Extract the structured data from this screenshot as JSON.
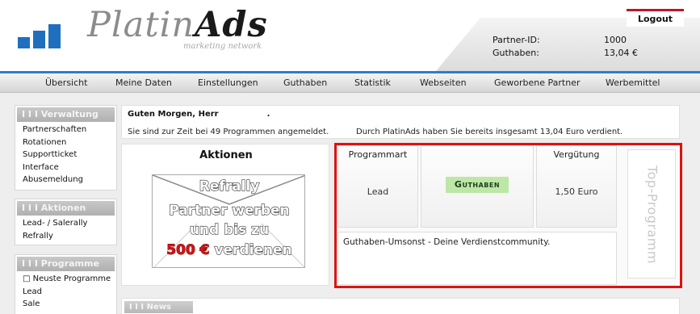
{
  "brand": {
    "name_light": "Platin",
    "name_bold": "Ads",
    "tagline": "marketing network"
  },
  "account": {
    "logout_label": "Logout",
    "partner_id_label": "Partner-ID:",
    "partner_id_value": "1000",
    "balance_label": "Guthaben:",
    "balance_value": "13,04 €"
  },
  "nav": {
    "items": [
      {
        "label": "Übersicht"
      },
      {
        "label": "Meine Daten"
      },
      {
        "label": "Einstellungen"
      },
      {
        "label": "Guthaben"
      },
      {
        "label": "Statistik"
      },
      {
        "label": "Webseiten"
      },
      {
        "label": "Geworbene Partner"
      },
      {
        "label": "Werbemittel"
      }
    ]
  },
  "sidebar": {
    "verwaltung": {
      "title": "I I I  Verwaltung",
      "items": [
        "Partnerschaften",
        "Rotationen",
        "Supportticket",
        "Interface",
        "Abusemeldung"
      ]
    },
    "aktionen": {
      "title": "I I I  Aktionen",
      "items": [
        "Lead- / Salerally",
        "Refrally"
      ]
    },
    "programme": {
      "title": "I I I  Programme",
      "items": [
        "□ Neuste Programme",
        "Lead",
        "Sale"
      ]
    }
  },
  "greeting": {
    "line1": "Guten Morgen, Herr",
    "line1_end": ".",
    "line2_left": "Sie sind zur Zeit bei 49 Programmen angemeldet.",
    "line2_right": "Durch PlatinAds haben Sie bereits insgesamt 13,04 Euro verdient."
  },
  "aktionen_panel": {
    "title": "Aktionen",
    "banner": {
      "line1": "Refrally",
      "line2": "Partner werben",
      "line3": "und bis zu",
      "amount": "500 €",
      "line4_tail": "verdienen"
    }
  },
  "top_program": {
    "programmart_header": "Programmart",
    "programmart_value": "Lead",
    "program_name": "Guthaben",
    "verguetung_header": "Vergütung",
    "verguetung_value": "1,50 Euro",
    "description": "Guthaben-Umsonst - Deine Verdienstcommunity.",
    "side_label": "Top-Programm"
  },
  "news": {
    "title": "I I I  News"
  },
  "colors": {
    "accent_blue": "#2b7dd0",
    "logout_red": "#c0152a",
    "highlight_frame": "#e01010",
    "badge_green": "#bde7a6"
  }
}
